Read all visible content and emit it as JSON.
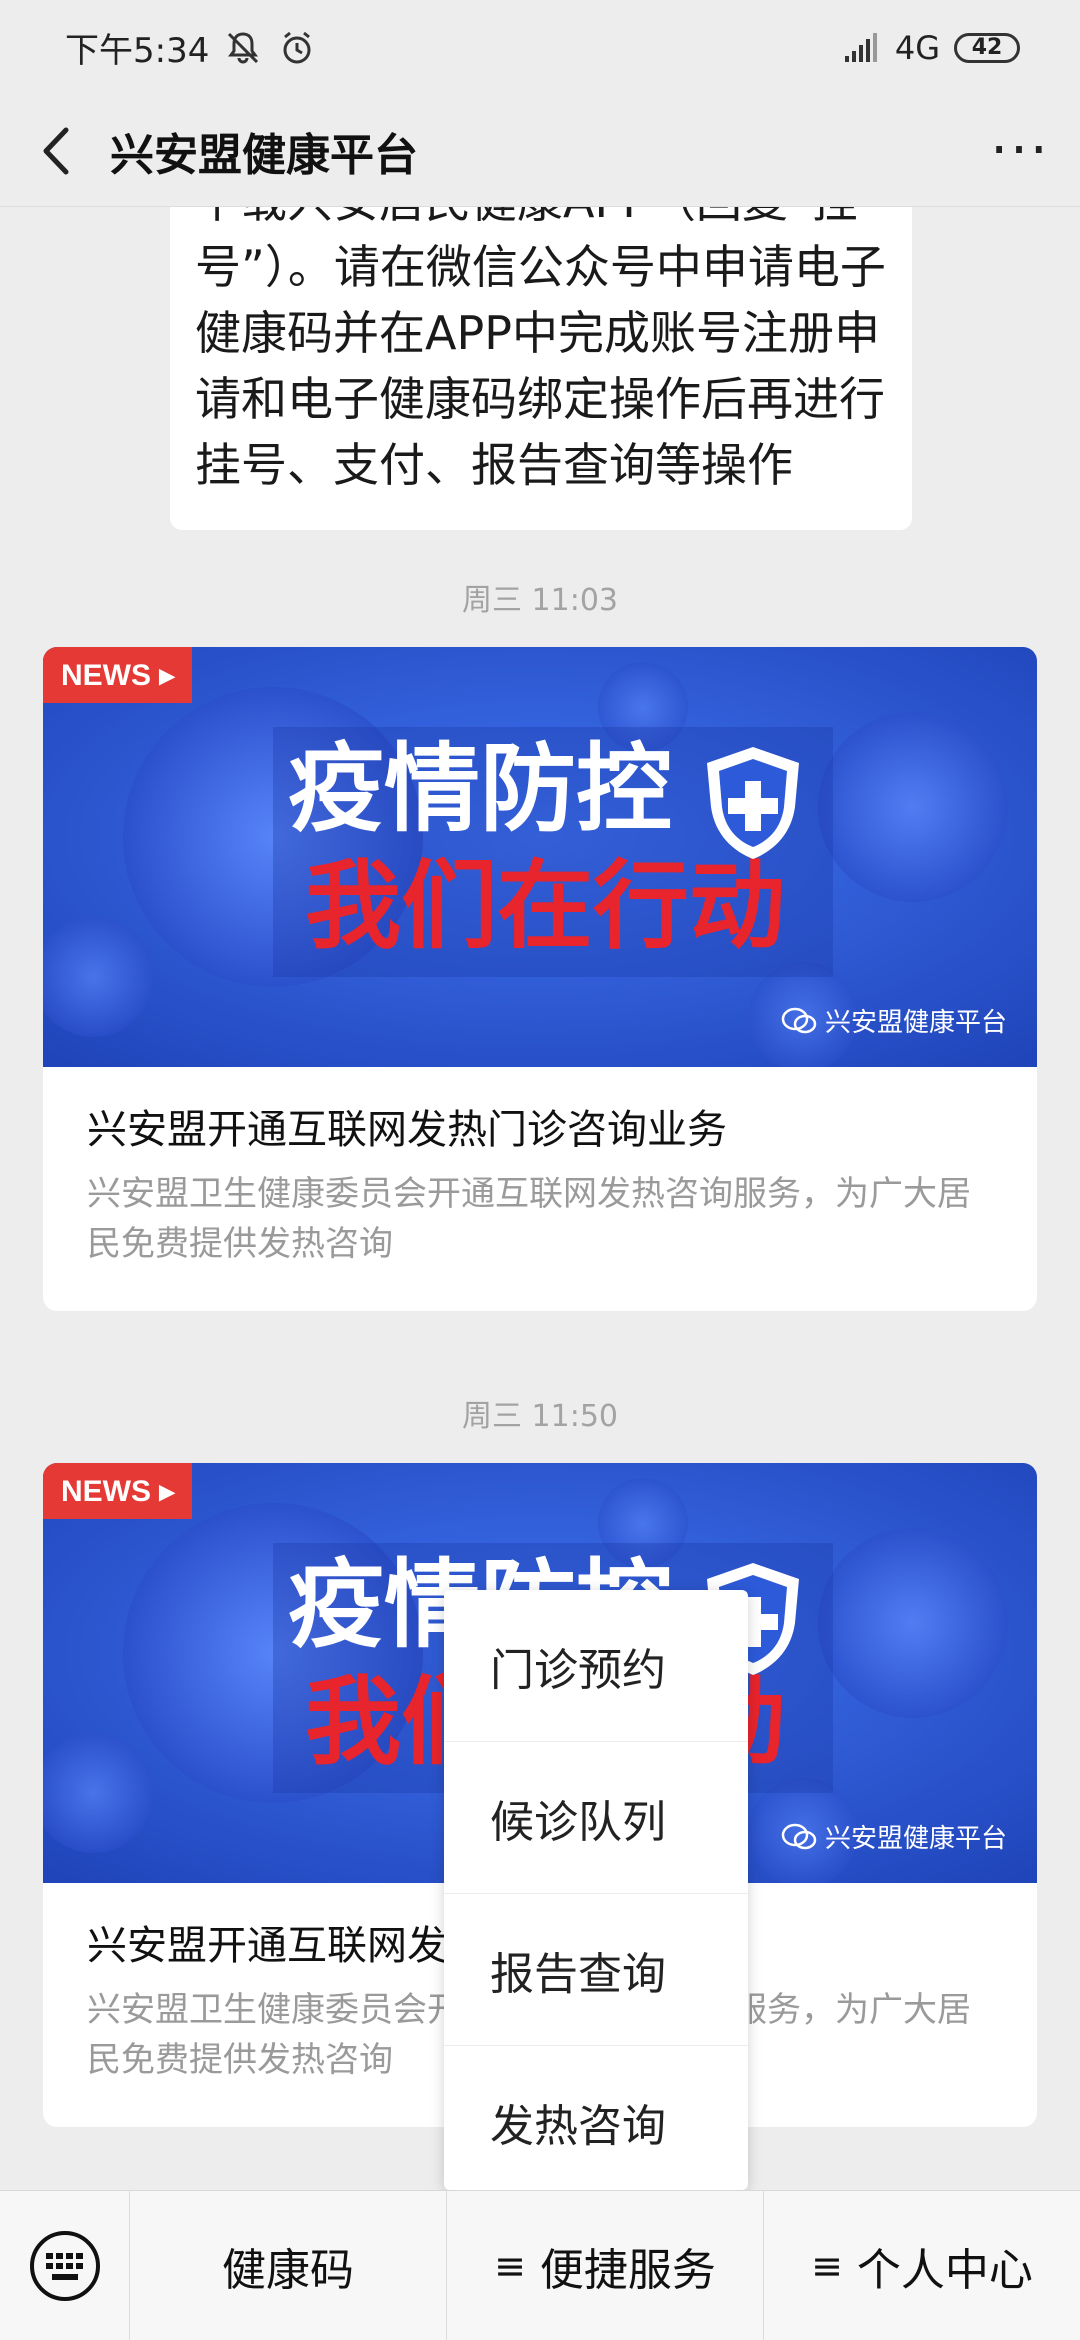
{
  "status_bar": {
    "time": "下午5:34",
    "network": "4G",
    "battery": "42"
  },
  "nav": {
    "title": "兴安盟健康平台",
    "back_icon": "chevron-left-icon",
    "more_icon": "more-icon",
    "more_label": "···"
  },
  "messages": {
    "text_bubble": "下载兴安居民健康APP（回复“挂号”）。请在微信公众号中申请电子健康码并在APP中完成账号注册申请和电子健康码绑定操作后再进行挂号、支付、报告查询等操作",
    "timestamp_1": "周三 11:03",
    "timestamp_2": "周三 11:50",
    "cards": [
      {
        "news_tag": "NEWS ▸",
        "image_line_1": "疫情防控",
        "image_line_2": "我们在行动",
        "watermark": "兴安盟健康平台",
        "title": "兴安盟开通互联网发热门诊咨询业务",
        "desc": "兴安盟卫生健康委员会开通互联网发热咨询服务，为广大居民免费提供发热咨询"
      },
      {
        "news_tag": "NEWS ▸",
        "image_line_1": "疫情防控",
        "image_line_2": "我们在行动",
        "watermark": "兴安盟健康平台",
        "title": "兴安盟开通互联网发热门诊咨询业务",
        "desc": "兴安盟卫生健康委员会开通互联网发热咨询服务，为广大居民免费提供发热咨询"
      }
    ]
  },
  "popup_menu": {
    "items": [
      "门诊预约",
      "候诊队列",
      "报告查询",
      "发热咨询"
    ]
  },
  "bottom_menu": {
    "keyboard_icon": "keyboard-icon",
    "items": [
      {
        "label": "健康码",
        "glyph": ""
      },
      {
        "label": "便捷服务",
        "glyph": "≡"
      },
      {
        "label": "个人中心",
        "glyph": "≡"
      }
    ]
  },
  "colors": {
    "background": "#ededed",
    "news_red": "#e53935",
    "image_blue": "#2f5fe0",
    "headline_red": "#e8242c"
  }
}
